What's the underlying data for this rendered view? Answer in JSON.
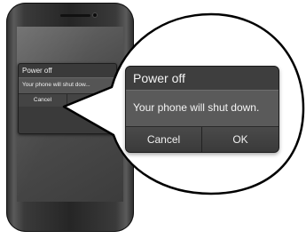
{
  "dialog": {
    "title": "Power off",
    "message": "Your phone will shut down.",
    "message_truncated": "Your phone will shut dow...",
    "cancel_label": "Cancel",
    "ok_label": "OK"
  },
  "colors": {
    "dialog_background": "#3e3e3e",
    "message_background": "#5a5a5a",
    "phone_body": "#2a2a2a",
    "callout_fill": "#ffffff",
    "callout_outline": "#000000"
  }
}
